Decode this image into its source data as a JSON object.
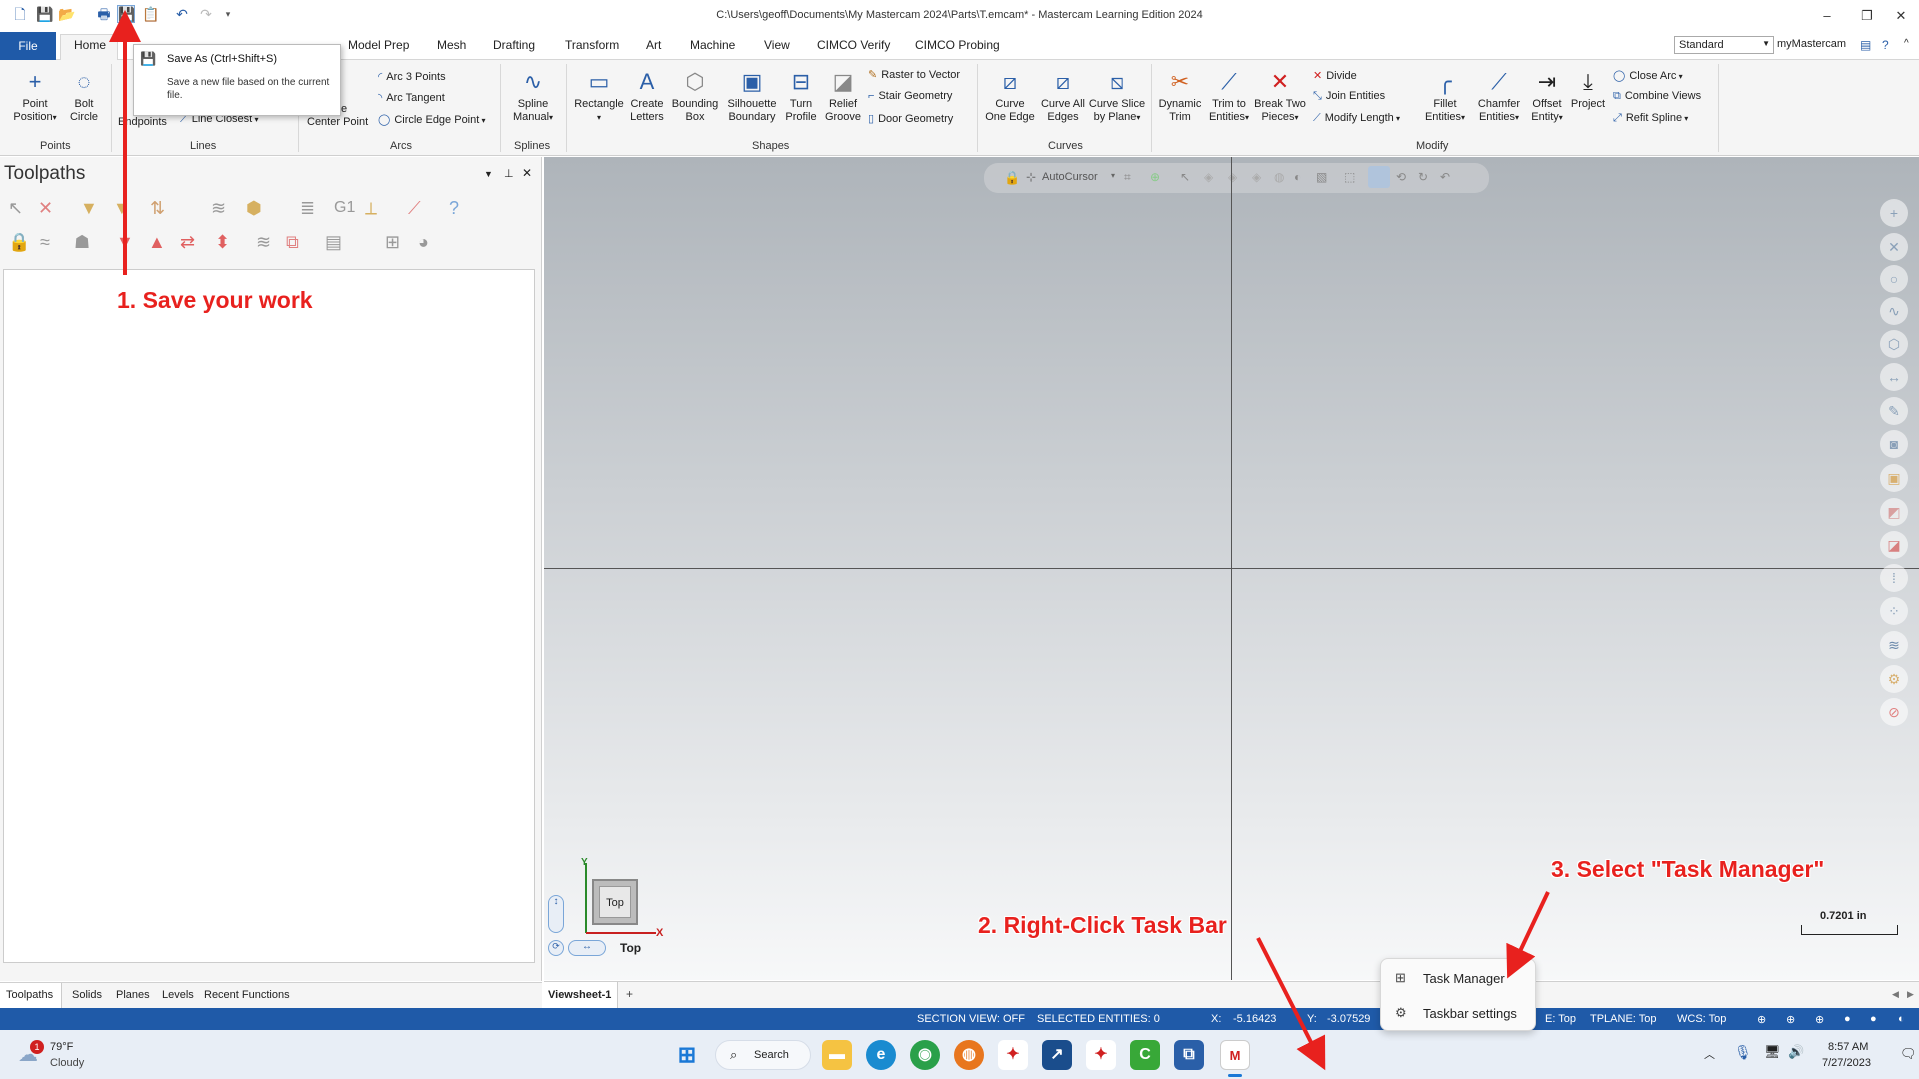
{
  "window": {
    "title": "C:\\Users\\geoff\\Documents\\My Mastercam 2024\\Parts\\T.emcam* - Mastercam Learning Edition 2024",
    "minimize": "–",
    "maximize": "❐",
    "close": "✕"
  },
  "ribbon_tabs": [
    "File",
    "Home",
    "Model Prep",
    "Mesh",
    "Drafting",
    "Transform",
    "Art",
    "Machine",
    "View",
    "CIMCO Verify",
    "CIMCO Probing"
  ],
  "ribbon_right": {
    "workspace_value": "Standard",
    "my_mastercam": "myMastercam"
  },
  "tooltip": {
    "title": "Save As (Ctrl+Shift+S)",
    "body": "Save a new file based on the current file."
  },
  "ribbon": {
    "points": {
      "group": "Points",
      "point_position": [
        "Point",
        "Position"
      ],
      "bolt_circle": [
        "Bolt",
        "Circle"
      ]
    },
    "lines": {
      "group": "Lines",
      "endpoints": "Endpoints",
      "line_closest": "Line Closest"
    },
    "arcs": {
      "group": "Arcs",
      "center_point_top": "cle",
      "center_point": "Center Point",
      "arc_3_points": "Arc 3 Points",
      "arc_tangent": "Arc Tangent",
      "circle_edge_point": "Circle Edge Point"
    },
    "splines": {
      "group": "Splines",
      "spline_manual": [
        "Spline",
        "Manual"
      ]
    },
    "shapes": {
      "group": "Shapes",
      "rectangle": "Rectangle",
      "create_letters": [
        "Create",
        "Letters"
      ],
      "bounding_box": [
        "Bounding",
        "Box"
      ],
      "silhouette": [
        "Silhouette",
        "Boundary"
      ],
      "turn_profile": [
        "Turn",
        "Profile"
      ],
      "relief_groove": [
        "Relief",
        "Groove"
      ],
      "raster_to_vector": "Raster to Vector",
      "stair_geometry": "Stair Geometry",
      "door_geometry": "Door Geometry"
    },
    "curves": {
      "group": "Curves",
      "curve_one_edge": [
        "Curve",
        "One Edge"
      ],
      "curve_all_edges": [
        "Curve All",
        "Edges"
      ],
      "curve_slice": [
        "Curve Slice",
        "by Plane"
      ]
    },
    "modify": {
      "group": "Modify",
      "dynamic_trim": [
        "Dynamic",
        "Trim"
      ],
      "trim_to_entities": [
        "Trim to",
        "Entities"
      ],
      "break_two_pieces": [
        "Break Two",
        "Pieces"
      ],
      "divide": "Divide",
      "join_entities": "Join Entities",
      "modify_length": "Modify Length",
      "fillet_entities": [
        "Fillet",
        "Entities"
      ],
      "chamfer_entities": [
        "Chamfer",
        "Entities"
      ],
      "offset_entity": [
        "Offset",
        "Entity"
      ],
      "project": "Project",
      "close_arc": "Close Arc",
      "combine_views": "Combine Views",
      "refit_spline": "Refit Spline"
    }
  },
  "toolpaths_panel": {
    "title": "Toolpaths",
    "g1": "G1"
  },
  "panel_tabs": [
    "Toolpaths",
    "Solids",
    "Planes",
    "Levels",
    "Recent Functions"
  ],
  "graphics": {
    "autocursor": "AutoCursor",
    "view_cube_label": "Top",
    "view_name": "Top",
    "axis_x": "X",
    "axis_y": "Y",
    "scale": "0.7201 in"
  },
  "viewsheet": {
    "tab": "Viewsheet-1",
    "add": "+"
  },
  "statusbar": {
    "section_view": "SECTION VIEW: OFF",
    "selected": "SELECTED ENTITIES: 0",
    "x_label": "X:",
    "x_value": "-5.16423",
    "y_label": "Y:",
    "y_value": "-3.07529",
    "gview": "E: Top",
    "tplane": "TPLANE: Top",
    "wcs": "WCS: Top"
  },
  "taskbar": {
    "weather_temp": "79°F",
    "weather_desc": "Cloudy",
    "weather_badge": "1",
    "search": "Search",
    "time": "8:57 AM",
    "date": "7/27/2023"
  },
  "context_menu": {
    "item1": "Task Manager",
    "item2": "Taskbar settings"
  },
  "annotations": {
    "step1": "1. Save your work",
    "step2": "2. Right-Click Task Bar",
    "step3": "3. Select \"Task Manager\""
  },
  "colors": {
    "accent": "#1f5aa8",
    "annotation": "#e8211e",
    "taskbar_bg": "#e8eef6"
  }
}
